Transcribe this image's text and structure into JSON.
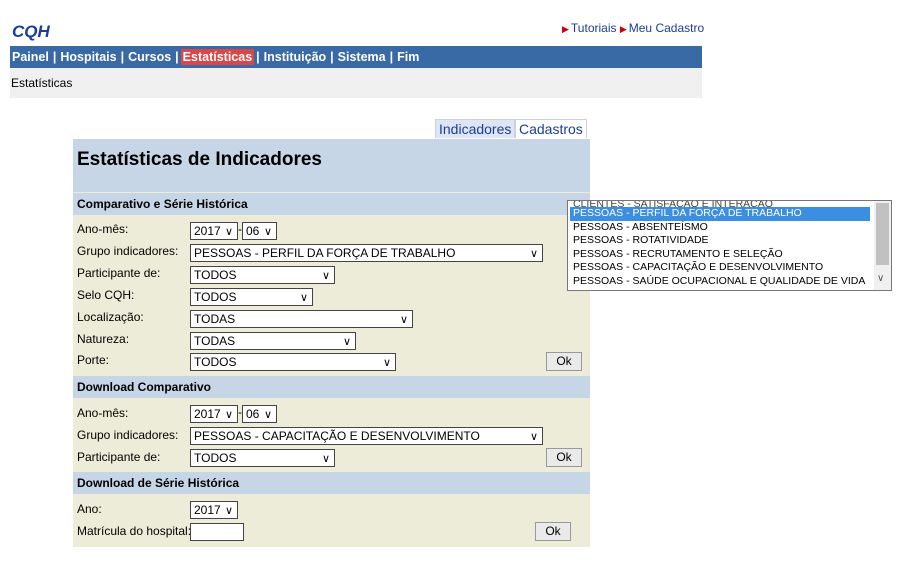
{
  "logo": "CQH",
  "top_links": [
    "Tutoriais",
    "Meu Cadastro"
  ],
  "nav": {
    "items": [
      "Painel",
      "Hospitais",
      "Cursos",
      "Estatísticas",
      "Instituição",
      "Sistema",
      "Fim"
    ],
    "active": "Estatísticas",
    "separator": "|"
  },
  "breadcrumb": "Estatísticas",
  "tabs": [
    "Indicadores",
    "Cadastros"
  ],
  "page_title": "Estatísticas de Indicadores",
  "section1": {
    "title": "Comparativo e Série Histórica",
    "labels": {
      "ano_mes": "Ano-mês:",
      "grupo": "Grupo indicadores:",
      "participante": "Participante de:",
      "selo": "Selo CQH:",
      "localizacao": "Localização:",
      "natureza": "Natureza:",
      "porte": "Porte:"
    },
    "values": {
      "ano": "2017",
      "mes": "06",
      "grupo": "PESSOAS - PERFIL DA FORÇA DE TRABALHO",
      "participante": "TODOS",
      "selo": "TODOS",
      "localizacao": "TODAS",
      "natureza": "TODAS",
      "porte": "TODOS"
    },
    "ok": "Ok"
  },
  "section2": {
    "title": "Download Comparativo",
    "labels": {
      "ano_mes": "Ano-mês:",
      "grupo": "Grupo indicadores:",
      "participante": "Participante de:"
    },
    "values": {
      "ano": "2017",
      "mes": "06",
      "grupo": "PESSOAS - CAPACITAÇÃO E DESENVOLVIMENTO",
      "participante": "TODOS"
    },
    "ok": "Ok"
  },
  "section3": {
    "title": "Download de Série Histórica",
    "labels": {
      "ano": "Ano:",
      "matricula": "Matrícula do hospital:"
    },
    "values": {
      "ano": "2017",
      "matricula": ""
    },
    "ok": "Ok"
  },
  "dropdown": {
    "cut_option": "CLIENTES - SATISFAÇÃO E INTERAÇÃO",
    "options": [
      "PESSOAS - PERFIL DA FORÇA DE TRABALHO",
      "PESSOAS - ABSENTEÍSMO",
      "PESSOAS - ROTATIVIDADE",
      "PESSOAS - RECRUTAMENTO E SELEÇÃO",
      "PESSOAS - CAPACITAÇÃO E DESENVOLVIMENTO",
      "PESSOAS - SAÚDE OCUPACIONAL E QUALIDADE DE VIDA"
    ],
    "selected_index": 0,
    "highlight_color": "#3c8fe0"
  },
  "colors": {
    "nav_bg": "#3a6aa6",
    "nav_active": "#d94848",
    "section_bg": "#c7d6e7",
    "panel_bg": "#ececd8",
    "link": "#1a3c9c"
  }
}
